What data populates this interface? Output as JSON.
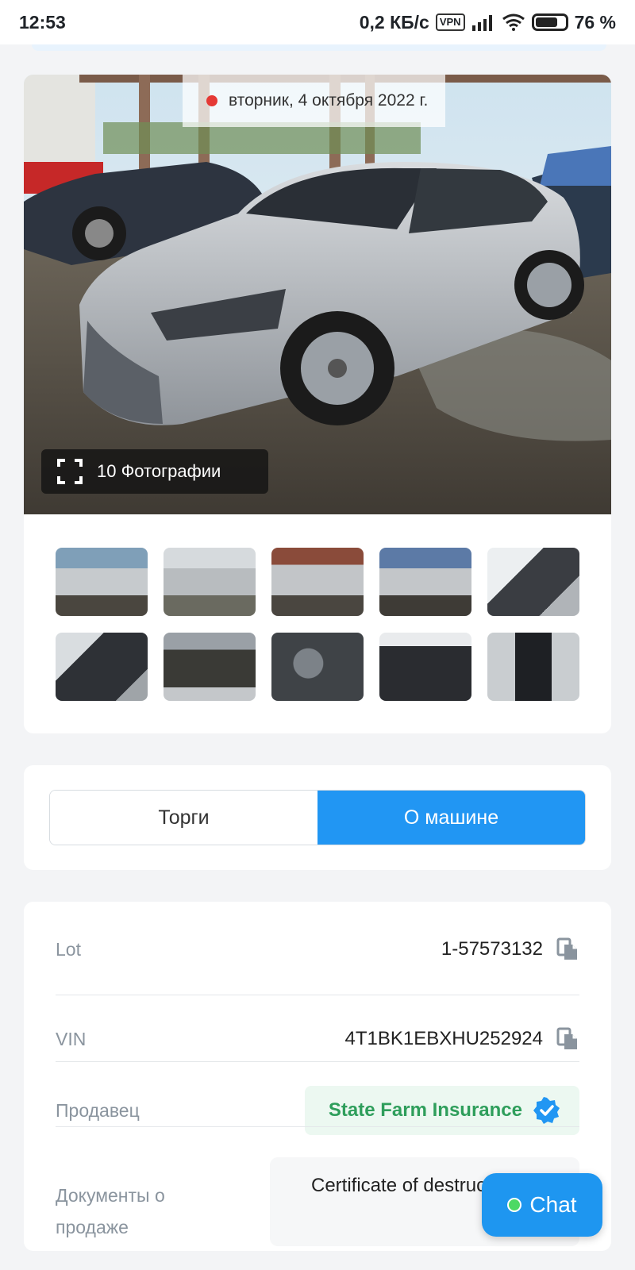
{
  "status_bar": {
    "time": "12:53",
    "network_speed": "0,2 КБ/с",
    "vpn": "VPN",
    "battery": "76 %"
  },
  "gallery": {
    "date": "вторник, 4 октября 2022 г.",
    "photos_button": "10 Фотографии",
    "thumbnails": [
      "thumb-1",
      "thumb-2",
      "thumb-3",
      "thumb-4",
      "thumb-5",
      "thumb-6",
      "thumb-7",
      "thumb-8",
      "thumb-9",
      "thumb-10"
    ]
  },
  "tabs": {
    "auction": "Торги",
    "about_car": "О машине",
    "active": "about_car"
  },
  "details": {
    "lot_label": "Lot",
    "lot_value": "1-57573132",
    "vin_label": "VIN",
    "vin_value": "4T1BK1EBXHU252924",
    "seller_label": "Продавец",
    "seller_value": "State Farm Insurance",
    "docs_label_line1": "Документы о",
    "docs_label_line2": "продаже",
    "docs_value": "Certificate of destruction"
  },
  "chat": {
    "label": "Chat",
    "status_color": "#4cd964"
  },
  "colors": {
    "accent": "#2196f3",
    "seller_green": "#2e9e5b",
    "live_red": "#e53935"
  }
}
